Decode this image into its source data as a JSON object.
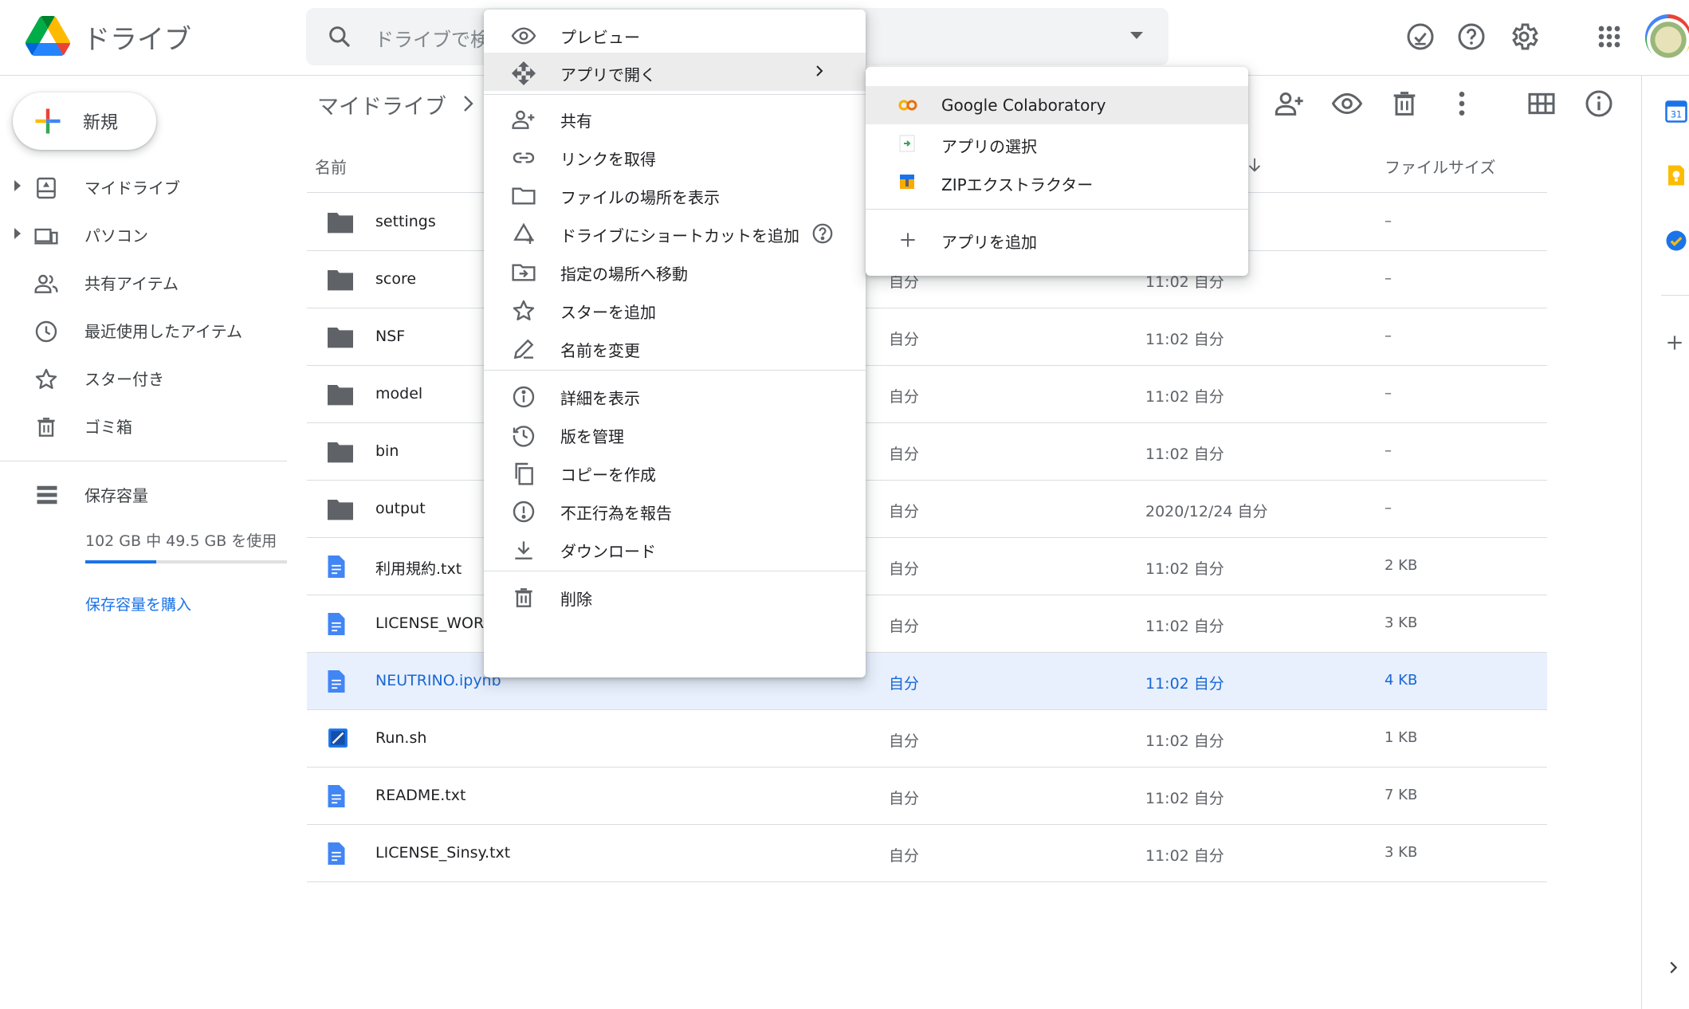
{
  "app": {
    "name": "ドライブ"
  },
  "search": {
    "placeholder": "ドライブで検"
  },
  "header_buttons": [
    "ready-for-offline-icon",
    "help-icon",
    "settings-icon",
    "apps-grid-icon"
  ],
  "new_button": {
    "label": "新規"
  },
  "sidebar": {
    "items": [
      {
        "label": "マイドライブ",
        "icon": "my-drive-icon"
      },
      {
        "label": "パソコン",
        "icon": "computers-icon"
      },
      {
        "label": "共有アイテム",
        "icon": "shared-icon"
      },
      {
        "label": "最近使用したアイテム",
        "icon": "recent-icon"
      },
      {
        "label": "スター付き",
        "icon": "star-icon"
      },
      {
        "label": "ゴミ箱",
        "icon": "trash-icon"
      }
    ],
    "storage": {
      "label": "保存容量",
      "usage": "102 GB 中 49.5 GB を使用",
      "used_fraction": 0.35,
      "buy": "保存容量を購入"
    }
  },
  "breadcrumb": {
    "title": "マイドライブ"
  },
  "toolbar": [
    "add-person-icon",
    "preview-icon",
    "trash-icon",
    "more-icon",
    "grid-view-icon",
    "info-icon"
  ],
  "columns": {
    "name": "名前",
    "size": "ファイルサイズ"
  },
  "files": [
    {
      "name": "settings",
      "type": "folder",
      "owner": "",
      "modified": "",
      "size": "–"
    },
    {
      "name": "score",
      "type": "folder",
      "owner": "自分",
      "modified": "11:02 自分",
      "size": "–"
    },
    {
      "name": "NSF",
      "type": "folder",
      "owner": "自分",
      "modified": "11:02 自分",
      "size": "–"
    },
    {
      "name": "model",
      "type": "folder",
      "owner": "自分",
      "modified": "11:02 自分",
      "size": "–"
    },
    {
      "name": "bin",
      "type": "folder",
      "owner": "自分",
      "modified": "11:02 自分",
      "size": "–"
    },
    {
      "name": "output",
      "type": "folder",
      "owner": "自分",
      "modified": "2020/12/24 自分",
      "size": "–"
    },
    {
      "name": "利用規約.txt",
      "type": "doc",
      "owner": "自分",
      "modified": "11:02 自分",
      "size": "2 KB"
    },
    {
      "name": "LICENSE_WORL",
      "type": "doc",
      "owner": "自分",
      "modified": "11:02 自分",
      "size": "3 KB"
    },
    {
      "name": "NEUTRINO.ipynb",
      "type": "doc",
      "owner": "自分",
      "modified": "11:02 自分",
      "size": "4 KB",
      "selected": true
    },
    {
      "name": "Run.sh",
      "type": "script",
      "owner": "自分",
      "modified": "11:02 自分",
      "size": "1 KB"
    },
    {
      "name": "README.txt",
      "type": "doc",
      "owner": "自分",
      "modified": "11:02 自分",
      "size": "7 KB"
    },
    {
      "name": "LICENSE_Sinsy.txt",
      "type": "doc",
      "owner": "自分",
      "modified": "11:02 自分",
      "size": "3 KB"
    }
  ],
  "context_menu": {
    "items": [
      {
        "label": "プレビュー",
        "icon": "preview-icon"
      },
      {
        "label": "アプリで開く",
        "icon": "open-with-icon",
        "submenu": true,
        "highlighted": true
      },
      {
        "label": "共有",
        "icon": "share-icon"
      },
      {
        "label": "リンクを取得",
        "icon": "link-icon"
      },
      {
        "label": "ファイルの場所を表示",
        "icon": "folder-icon"
      },
      {
        "label": "ドライブにショートカットを追加",
        "icon": "add-shortcut-icon",
        "help": true
      },
      {
        "label": "指定の場所へ移動",
        "icon": "move-icon"
      },
      {
        "label": "スターを追加",
        "icon": "star-icon"
      },
      {
        "label": "名前を変更",
        "icon": "rename-icon"
      },
      {
        "label": "詳細を表示",
        "icon": "info-icon"
      },
      {
        "label": "版を管理",
        "icon": "history-icon"
      },
      {
        "label": "コピーを作成",
        "icon": "copy-icon"
      },
      {
        "label": "不正行為を報告",
        "icon": "report-icon"
      },
      {
        "label": "ダウンロード",
        "icon": "download-icon"
      },
      {
        "label": "削除",
        "icon": "trash-icon"
      }
    ]
  },
  "submenu": {
    "items": [
      {
        "label": "Google Colaboratory",
        "icon": "colab-icon",
        "highlighted": true
      },
      {
        "label": "アプリの選択",
        "icon": "choose-app-icon"
      },
      {
        "label": "ZIPエクストラクター",
        "icon": "zip-extractor-icon"
      },
      {
        "label": "アプリを追加",
        "icon": "plus-icon"
      }
    ]
  },
  "colors": {
    "accent": "#1a73e8",
    "selected_row": "#e8f0fe",
    "menu_highlight": "#ececec"
  }
}
